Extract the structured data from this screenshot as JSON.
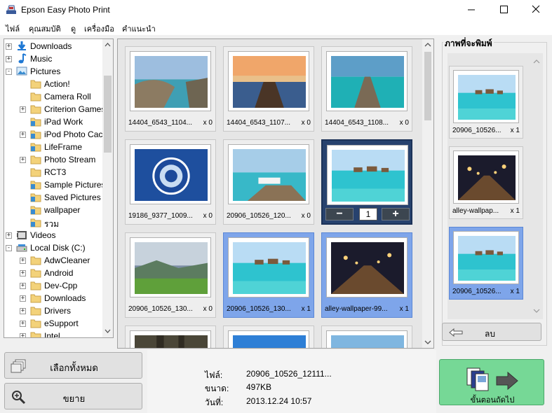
{
  "window": {
    "title": "Epson Easy Photo Print",
    "controls": [
      "minimize",
      "maximize",
      "close"
    ]
  },
  "menu": [
    "ไฟล์",
    "คุณสมบัติ",
    "ดู",
    "เครื่องมือ",
    "คำแนะนำ"
  ],
  "tree": [
    {
      "label": "Downloads",
      "indent": 0,
      "icon": "download-icon",
      "expander": "+"
    },
    {
      "label": "Music",
      "indent": 0,
      "icon": "music-icon",
      "expander": "+"
    },
    {
      "label": "Pictures",
      "indent": 0,
      "icon": "pictures-icon",
      "expander": "-"
    },
    {
      "label": "Action!",
      "indent": 1,
      "icon": "folder-icon",
      "expander": ""
    },
    {
      "label": "Camera Roll",
      "indent": 1,
      "icon": "folder-icon",
      "expander": ""
    },
    {
      "label": "Criterion Games",
      "indent": 1,
      "icon": "folder-icon",
      "expander": "+"
    },
    {
      "label": "iPad Work",
      "indent": 1,
      "icon": "folder-image-icon",
      "expander": ""
    },
    {
      "label": "iPod Photo Cach",
      "indent": 1,
      "icon": "folder-image-icon",
      "expander": "+"
    },
    {
      "label": "LifeFrame",
      "indent": 1,
      "icon": "folder-image-icon",
      "expander": ""
    },
    {
      "label": "Photo Stream",
      "indent": 1,
      "icon": "folder-icon",
      "expander": "+"
    },
    {
      "label": "RCT3",
      "indent": 1,
      "icon": "folder-icon",
      "expander": ""
    },
    {
      "label": "Sample Pictures",
      "indent": 1,
      "icon": "folder-image-icon",
      "expander": ""
    },
    {
      "label": "Saved Pictures",
      "indent": 1,
      "icon": "folder-image-icon",
      "expander": ""
    },
    {
      "label": "wallpaper",
      "indent": 1,
      "icon": "folder-image-icon",
      "expander": "",
      "selected": true
    },
    {
      "label": "รวม",
      "indent": 1,
      "icon": "folder-image-icon",
      "expander": ""
    },
    {
      "label": "Videos",
      "indent": 0,
      "icon": "video-icon",
      "expander": "+"
    },
    {
      "label": "Local Disk (C:)",
      "indent": 0,
      "icon": "drive-icon",
      "expander": "-"
    },
    {
      "label": "AdwCleaner",
      "indent": 1,
      "icon": "folder-icon",
      "expander": "+"
    },
    {
      "label": "Android",
      "indent": 1,
      "icon": "folder-icon",
      "expander": "+"
    },
    {
      "label": "Dev-Cpp",
      "indent": 1,
      "icon": "folder-icon",
      "expander": "+"
    },
    {
      "label": "Downloads",
      "indent": 1,
      "icon": "folder-icon",
      "expander": "+"
    },
    {
      "label": "Drivers",
      "indent": 1,
      "icon": "folder-icon",
      "expander": "+"
    },
    {
      "label": "eSupport",
      "indent": 1,
      "icon": "folder-icon",
      "expander": "+"
    },
    {
      "label": "Intel",
      "indent": 1,
      "icon": "folder-icon",
      "expander": "+"
    }
  ],
  "thumbnails": [
    {
      "name": "14404_6543_1104...",
      "count": "x 0",
      "scene": "rocky-coast",
      "state": "normal"
    },
    {
      "name": "14404_6543_1107...",
      "count": "x 0",
      "scene": "pier-sunset",
      "state": "normal"
    },
    {
      "name": "14404_6543_1108...",
      "count": "x 0",
      "scene": "pier-teal",
      "state": "normal"
    },
    {
      "name": "19186_9377_1009...",
      "count": "x 0",
      "scene": "chelsea-logo",
      "state": "normal"
    },
    {
      "name": "20906_10526_120...",
      "count": "x 0",
      "scene": "beach-chairs",
      "state": "normal"
    },
    {
      "name": "",
      "count": "",
      "scene": "overwater-villas",
      "state": "focused",
      "quantity": "1"
    },
    {
      "name": "20906_10526_130...",
      "count": "x 0",
      "scene": "green-valley",
      "state": "normal"
    },
    {
      "name": "20906_10526_130...",
      "count": "x 1",
      "scene": "overwater-villas",
      "state": "selected"
    },
    {
      "name": "alley-wallpaper-99...",
      "count": "x 1",
      "scene": "night-alley",
      "state": "selected"
    },
    {
      "name": "",
      "count": "",
      "scene": "forest",
      "state": "normal"
    },
    {
      "name": "",
      "count": "",
      "scene": "blue-sky",
      "state": "normal"
    },
    {
      "name": "",
      "count": "",
      "scene": "mountain-lake",
      "state": "normal"
    }
  ],
  "print_panel": {
    "title": "ภาพที่จะพิมพ์",
    "items": [
      {
        "name": "20906_10526...",
        "count": "x 1",
        "scene": "overwater-villas",
        "state": "normal"
      },
      {
        "name": "alley-wallpap...",
        "count": "x 1",
        "scene": "night-alley",
        "state": "normal"
      },
      {
        "name": "20906_10526...",
        "count": "x 1",
        "scene": "overwater-villas",
        "state": "selected"
      }
    ],
    "delete_label": "ลบ"
  },
  "buttons": {
    "select_all": "เลือกทั้งหมด",
    "zoom": "ขยาย",
    "next": "ขั้นตอนถัดไป"
  },
  "file_info": {
    "file_label": "ไฟล์:",
    "file_value": "20906_10526_12111...",
    "size_label": "ขนาด:",
    "size_value": "497KB",
    "date_label": "วันที่:",
    "date_value": "2013.12.24 10:57"
  },
  "colors": {
    "selected_tile": "#7ea5ea",
    "focused_tile": "#27426e",
    "next_button": "#76d896"
  }
}
